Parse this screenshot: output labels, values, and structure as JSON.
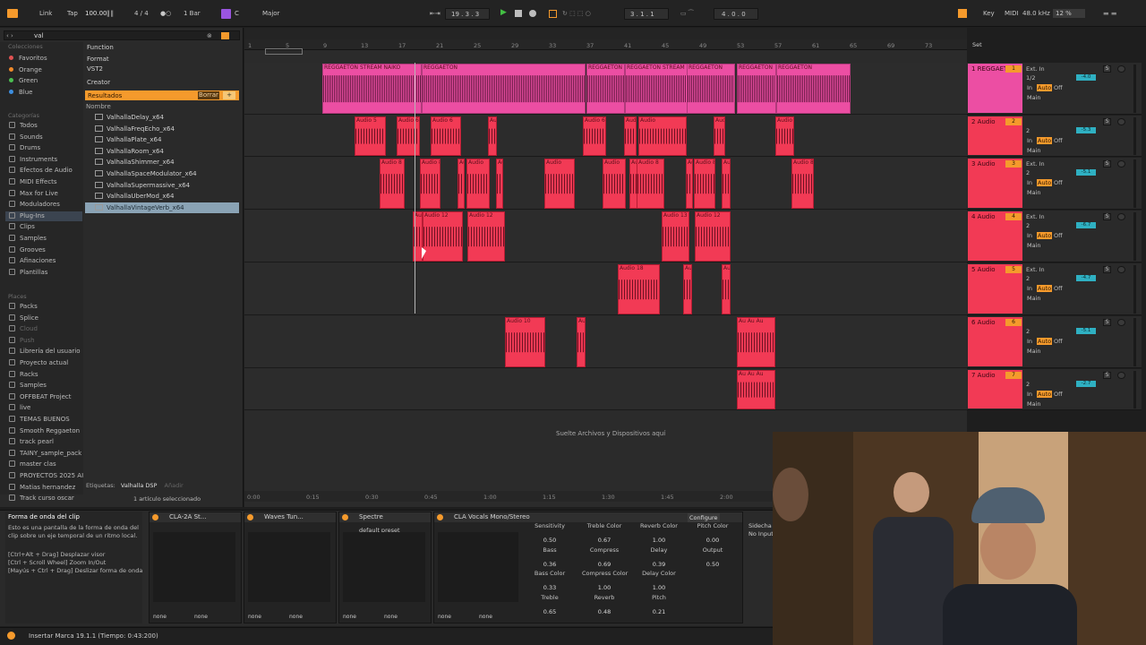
{
  "topbar": {
    "link": "Link",
    "tap": "Tap",
    "tempo": "100.00",
    "signature": "4 / 4",
    "quantize": "1 Bar",
    "key": "C",
    "scale": "Major",
    "position": "19 .  3 .  3",
    "loop_start": "3 .  1 .  1",
    "loop_length": "4 .  0 .  0",
    "key_label": "Key",
    "midi_label": "MIDI",
    "sample_rate": "48.0 kHz",
    "cpu": "12 %"
  },
  "browser": {
    "search": "val",
    "colecciones_header": "Colecciones",
    "collections": [
      {
        "label": "Favoritos",
        "color": "#e05252"
      },
      {
        "label": "Orange",
        "color": "#f08a2a"
      },
      {
        "label": "Green",
        "color": "#4bbf52"
      },
      {
        "label": "Blue",
        "color": "#3d8fe0"
      }
    ],
    "categories_header": "Categorías",
    "categories": [
      "Todos",
      "Sounds",
      "Drums",
      "Instruments",
      "Efectos de Audio",
      "MIDI Effects",
      "Max for Live",
      "Moduladores",
      "Plug-Ins",
      "Clips",
      "Samples",
      "Grooves",
      "Afinaciones",
      "Plantillas"
    ],
    "places_header": "Places",
    "places": [
      "Packs",
      "Splice",
      "Cloud",
      "Push",
      "Librería del usuario",
      "Proyecto actual",
      "Racks",
      "Samples",
      "OFFBEAT Project",
      "live",
      "TEMAS BUENOS",
      "Smooth Reggaeton",
      "track pearl",
      "TAINY_sample_pack",
      "master clas",
      "PROYECTOS 2025 AI",
      "Matias hernandez",
      "Track curso oscar"
    ],
    "filters": [
      "Function",
      "Format",
      "VST2",
      "Creator"
    ],
    "results_label": "Resultados",
    "clear_label": "Borrar",
    "name_header": "Nombre",
    "results": [
      "ValhallaDelay_x64",
      "ValhallaFreqEcho_x64",
      "ValhallaPlate_x64",
      "ValhallaRoom_x64",
      "ValhallaShimmer_x64",
      "ValhallaSpaceModulator_x64",
      "ValhallaSupermassive_x64",
      "ValhallaUberMod_x64",
      "ValhallaVintageVerb_x64"
    ],
    "tags_label": "Etiquetas:",
    "tag_value": "Valhalla DSP",
    "tag_add": "Añadir",
    "selection_count": "1 artículo seleccionado"
  },
  "ruler": [
    "1",
    "5",
    "9",
    "13",
    "17",
    "21",
    "25",
    "29",
    "33",
    "37",
    "41",
    "45",
    "49",
    "53",
    "57",
    "61",
    "65",
    "69",
    "73"
  ],
  "timeline": [
    "0:00",
    "0:15",
    "0:30",
    "0:45",
    "1:00",
    "1:15",
    "1:30",
    "1:45",
    "2:00"
  ],
  "drop_hint": "Suelte Archivos y Dispositivos aquí",
  "set_label": "Set",
  "tracks": [
    {
      "name": "1 REGGAETON",
      "num": "1",
      "input": "Ext. In",
      "ch": "1/2",
      "vol": "-4.0",
      "color": "#ec4ea3",
      "clips": [
        "REGGAETON STREAM NAIKO",
        "REGGAETON",
        "REGGAETON",
        "REGGAETON STREAM NA",
        "REGGAETON",
        "REGGAETON",
        "REGGAETON"
      ]
    },
    {
      "name": "2 Audio",
      "num": "2",
      "input": "",
      "ch": "2",
      "vol": "-5.3",
      "color": "#f23a55",
      "clips": [
        "Audio 5",
        "Audio 6",
        "Audio 6",
        "Audio 6",
        "Audio 6",
        "Audio 6",
        "Audio",
        "Audio"
      ]
    },
    {
      "name": "3 Audio",
      "num": "3",
      "input": "Ext. In",
      "ch": "2",
      "vol": "-5.1",
      "color": "#f23a55",
      "clips": [
        "Audio 8",
        "Audio 8",
        "Audio",
        "Audio",
        "Audio 8",
        "Audio",
        "Audio",
        "Audio",
        "Audio 8"
      ]
    },
    {
      "name": "4 Audio",
      "num": "4",
      "input": "Ext. In",
      "ch": "2",
      "vol": "-6.7",
      "color": "#f23a55",
      "clips": [
        "Audio 13",
        "Audio 12",
        "Audio 12",
        "Audio 13",
        "Audio 12"
      ]
    },
    {
      "name": "5 Audio",
      "num": "5",
      "input": "Ext. In",
      "ch": "2",
      "vol": "-4.7",
      "color": "#f23a55",
      "clips": [
        "Audio 18",
        "Au",
        "Au"
      ]
    },
    {
      "name": "6 Audio",
      "num": "6",
      "input": "",
      "ch": "2",
      "vol": "-5.1",
      "color": "#f23a55",
      "clips": [
        "Audio 10",
        "Au",
        "Au Au Au"
      ]
    },
    {
      "name": "7 Audio",
      "num": "7",
      "input": "",
      "ch": "2",
      "vol": "-2.7",
      "color": "#f23a55",
      "clips": [
        "Au Au Au"
      ]
    }
  ],
  "mixer_labels": {
    "in": "In",
    "auto": "Auto",
    "off": "Off",
    "main": "Main",
    "solo": "S"
  },
  "info": {
    "title": "Forma de onda del clip",
    "body": "Esto es una pantalla de la forma de onda del clip sobre un eje temporal de un ritmo local.",
    "hint1": "[Ctrl+Alt + Drag] Desplazar visor",
    "hint2": "[Ctrl + Scroll Wheel] Zoom In/Out",
    "hint3": "[Mayús + Ctrl + Drag] Deslizar forma de onda"
  },
  "devices": [
    {
      "name": "CLA-2A St..."
    },
    {
      "name": "Waves Tun..."
    },
    {
      "name": "Spectre",
      "preset": "default preset"
    },
    {
      "name": "CLA Vocals Mono/Stereo",
      "configure": "Configure"
    }
  ],
  "device_none": "none",
  "cla_params": [
    {
      "label": "Sensitivity",
      "value": "0.50"
    },
    {
      "label": "Treble Color",
      "value": "0.67"
    },
    {
      "label": "Reverb Color",
      "value": "1.00"
    },
    {
      "label": "Pitch Color",
      "value": "0.00"
    },
    {
      "label": "Bass",
      "value": "0.36"
    },
    {
      "label": "Compress",
      "value": "0.69"
    },
    {
      "label": "Delay",
      "value": "0.39"
    },
    {
      "label": "Output",
      "value": "0.50"
    },
    {
      "label": "Bass Color",
      "value": "0.33"
    },
    {
      "label": "Compress Color",
      "value": "1.00"
    },
    {
      "label": "Delay Color",
      "value": "1.00"
    },
    {
      "label": "Treble",
      "value": "0.65"
    },
    {
      "label": "Reverb",
      "value": "0.48"
    },
    {
      "label": "Pitch",
      "value": "0.21"
    }
  ],
  "sidechain": {
    "label": "Sidecha",
    "value": "No Input"
  },
  "status": "Insertar Marca 19.1.1 (Tiempo: 0:43:200)"
}
